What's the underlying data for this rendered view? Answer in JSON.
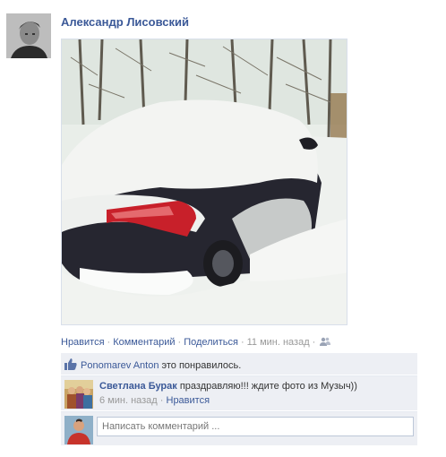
{
  "post": {
    "author": "Александр Лисовский",
    "author_avatar_icon": "user-avatar",
    "photo_icon": "snow-covered-car-photo"
  },
  "actions": {
    "like": "Нравится",
    "comment": "Комментарий",
    "share": "Поделиться",
    "time": "11 мин. назад",
    "audience_icon": "friends-icon"
  },
  "likes": {
    "user": "Ponomarev Anton",
    "text": "это понравилось."
  },
  "comments": [
    {
      "author": "Светлана Бурак",
      "text": "праздравляю!!! ждите фото из Музыч))",
      "time": "6 мин. назад",
      "like": "Нравится"
    }
  ],
  "composer": {
    "placeholder": "Написать комментарий ..."
  },
  "colors": {
    "link": "#3b5998",
    "ufi_background": "#edeff4",
    "meta_text": "#999999"
  }
}
